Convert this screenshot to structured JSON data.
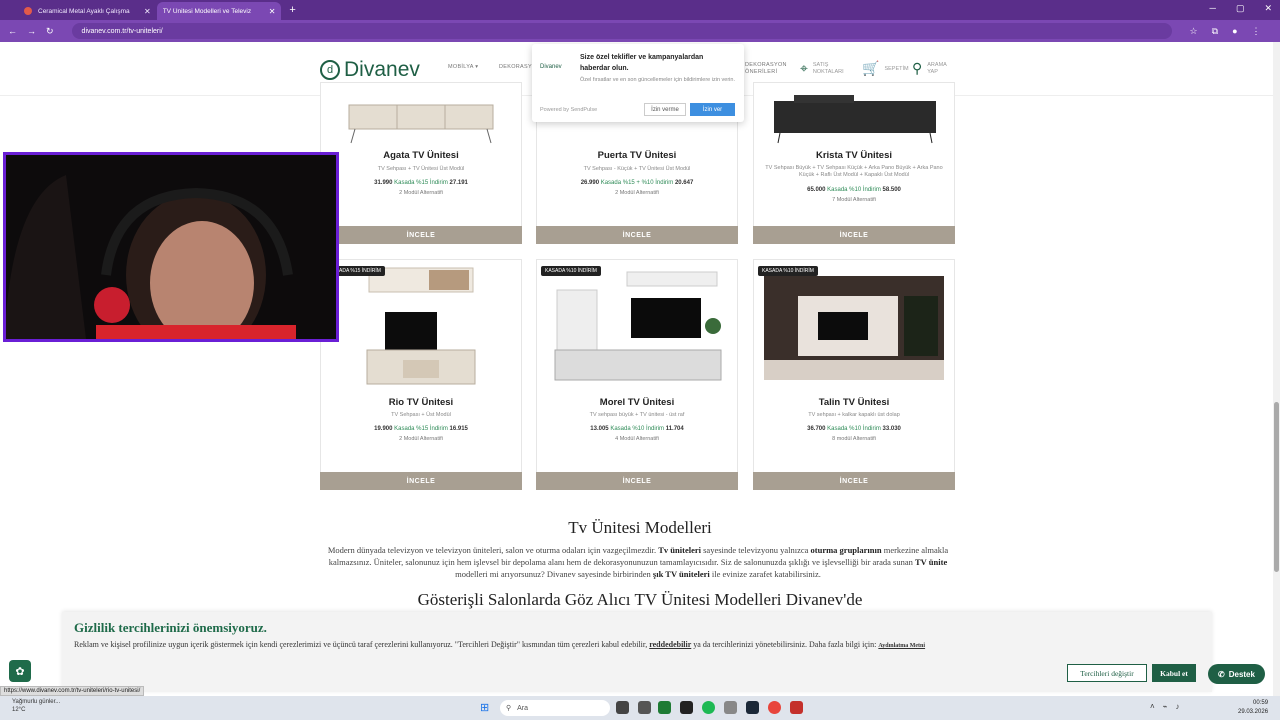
{
  "browser": {
    "tabs": [
      {
        "label": "Ceramical Metal Ayaklı Çalışma"
      },
      {
        "label": "TV Ünitesi Modelleri ve Televiz"
      }
    ],
    "url": "divanev.com.tr/tv-uniteleri/"
  },
  "site": {
    "logo": "Divanev",
    "nav": {
      "mobilya": "MOBİLYA ▾",
      "dekorasyon": "DEKORASY",
      "dekorasyon_oneri": "DEKORASYON ÖNERİLERİ",
      "satis_noktalari": "SATIŞ NOKTALARI",
      "sepetim": "SEPETİM",
      "arama": "ARAMA YAP"
    }
  },
  "push_popup": {
    "logo": "Divanev",
    "title": "Size özel teklifler ve kampanyalardan haberdar olun.",
    "body": "Özel fırsatlar ve en son güncellemeler için bildirimlere izin verin.",
    "powered": "Powered by SendPulse",
    "deny_label": "İzin verme",
    "allow_label": "İzin ver"
  },
  "products_row1": [
    {
      "title": "Agata TV Ünitesi",
      "desc": "TV Sehpası + TV Ünitesi Üst Modül",
      "price": "31.990",
      "discount": "Kasada %15 İndirim",
      "final": "27.191",
      "alt": "2 Modül Alternatifi",
      "button": "İNCELE"
    },
    {
      "title": "Puerta TV Ünitesi",
      "desc": "TV Sehpası - Küçük + TV Ünitesi Üst Modül",
      "price": "26.990",
      "discount": "Kasada %15 + %10 İndirim",
      "final": "20.647",
      "alt": "2 Modül Alternatifi",
      "button": "İNCELE"
    },
    {
      "title": "Krista TV Ünitesi",
      "desc": "TV Sehpası Büyük + TV Sehpası Küçük + Arka Pano Büyük + Arka Pano Küçük + Raflı Üst Modül + Kapaklı Üst Modül",
      "price": "65.000",
      "discount": "Kasada %10 İndirim",
      "final": "58.500",
      "alt": "7 Modül Alternatifi",
      "button": "İNCELE"
    }
  ],
  "products_row2": [
    {
      "tag": "KASADA %15 İNDİRİM",
      "title": "Rio TV Ünitesi",
      "desc": "TV Sehpası + Üst Modül",
      "price": "19.900",
      "discount": "Kasada %15 İndirim",
      "final": "16.915",
      "alt": "2 Modül Alternatifi",
      "button": "İNCELE"
    },
    {
      "tag": "KASADA %10 İNDİRİM",
      "title": "Morel TV Ünitesi",
      "desc": "TV sehpası büyük + TV ünitesi - üst raf",
      "price": "13.005",
      "discount": "Kasada %10 İndirim",
      "final": "11.704",
      "alt": "4 Modül Alternatifi",
      "button": "İNCELE"
    },
    {
      "tag": "KASADA %10 İNDİRİM",
      "title": "Talin TV Ünitesi",
      "desc": "TV sehpası + kalkar kapaklı üst dolap",
      "price": "36.700",
      "discount": "Kasada %10 İndirim",
      "final": "33.030",
      "alt": "8 modül Alternatifi",
      "button": "İNCELE"
    }
  ],
  "section": {
    "title": "Tv Ünitesi Modelleri",
    "para_1": "Modern dünyada televizyon ve televizyon üniteleri, salon ve oturma odaları için vazgeçilmezdir.",
    "para_b1": "Tv üniteleri",
    "para_2": "sayesinde televizyonu yalnızca",
    "para_b2": "oturma gruplarının",
    "para_3": "merkezine almakla kalmazsınız. Üniteler, salonunuz için hem işlevsel bir depolama alanı hem de dekorasyonunuzun tamamlayıcısıdır. Siz de salonunuzda şıklığı ve işlevselliği bir arada sunan",
    "para_b3": "TV ünite",
    "para_4": "modelleri mi arıyorsunuz? Divanev sayesinde birbirinden",
    "para_b4": "şık TV üniteleri",
    "para_5": "ile evinize zarafet katabilirsiniz.",
    "subtitle": "Gösterişli Salonlarda Göz Alıcı TV Ünitesi Modelleri Divanev'de"
  },
  "cookie": {
    "title": "Gizlilik tercihlerinizi önemsiyoruz.",
    "body": "Reklam ve kişisel profilinize uygun içerik göstermek için kendi çerezlerimizi ve üçüncü taraf çerezlerini kullanıyoruz. \"Tercihleri Değiştir\" kısmından tüm çerezleri kabul edebilir,",
    "reject": "reddedebilir",
    "body2": "ya da tercihlerinizi yönetebilirsiniz. Daha fazla bilgi için:",
    "link": "Aydınlatma Metni",
    "prefs_label": "Tercihleri değiştir",
    "accept_label": "Kabul et"
  },
  "destek_label": "Destek",
  "status_url": "https://www.divanev.com.tr/tv-uniteleri/rio-tv-unitesi/",
  "taskbar": {
    "weather_line1": "Yağmurlu günler...",
    "weather_line2": "12°C",
    "search_label": "Ara",
    "time": "00:59",
    "date": "29.03.2026"
  },
  "colors": {
    "brand": "#1f5f45",
    "browser": "#7b48b3",
    "button": "#a89f92",
    "webcam_border": "#6a1fd6"
  }
}
